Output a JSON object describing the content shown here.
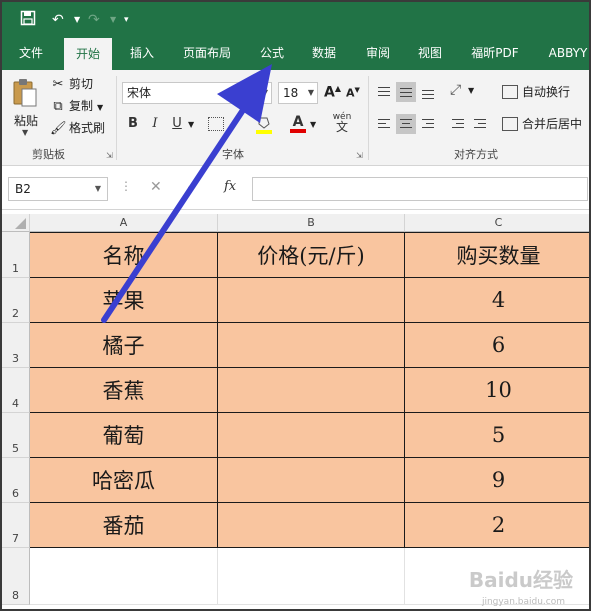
{
  "quick_access": {
    "save_icon": "save-icon",
    "undo_icon": "undo-icon",
    "redo_icon": "redo-icon",
    "customize_icon": "customize-icon"
  },
  "tabs": [
    {
      "label": "文件"
    },
    {
      "label": "开始"
    },
    {
      "label": "插入"
    },
    {
      "label": "页面布局"
    },
    {
      "label": "公式"
    },
    {
      "label": "数据"
    },
    {
      "label": "审阅"
    },
    {
      "label": "视图"
    },
    {
      "label": "福昕PDF"
    },
    {
      "label": "ABBYY"
    }
  ],
  "ribbon": {
    "clipboard": {
      "paste_label": "粘贴",
      "cut_label": "剪切",
      "copy_label": "复制",
      "format_painter_label": "格式刷",
      "group_label": "剪贴板"
    },
    "font": {
      "font_name": "宋体",
      "font_size": "18",
      "group_label": "字体",
      "bold": "B",
      "italic": "I",
      "underline": "U",
      "grow": "A",
      "shrink": "A",
      "font_color_glyph": "A",
      "phonetic_glyph": "wén"
    },
    "alignment": {
      "wrap_text_label": "自动换行",
      "merge_center_label": "合并后居中",
      "group_label": "对齐方式"
    }
  },
  "formula_bar": {
    "name_box": "B2",
    "fx": "fx",
    "cancel": "✕",
    "enter": "✓",
    "value": ""
  },
  "sheet": {
    "columns": [
      "A",
      "B",
      "C"
    ],
    "rows": [
      {
        "num": "1",
        "a": "名称",
        "b": "价格(元/斤)",
        "c": "购买数量"
      },
      {
        "num": "2",
        "a": "苹果",
        "b": "",
        "c": "4"
      },
      {
        "num": "3",
        "a": "橘子",
        "b": "",
        "c": "6"
      },
      {
        "num": "4",
        "a": "香蕉",
        "b": "",
        "c": "10"
      },
      {
        "num": "5",
        "a": "葡萄",
        "b": "",
        "c": "5"
      },
      {
        "num": "6",
        "a": "哈密瓜",
        "b": "",
        "c": "9"
      },
      {
        "num": "7",
        "a": "番茄",
        "b": "",
        "c": "2"
      },
      {
        "num": "8",
        "a": "",
        "b": "",
        "c": ""
      }
    ],
    "fill_color": "#f9c59f"
  },
  "colors": {
    "excel_green": "#217346",
    "arrow": "#3a3fd0",
    "highlight_yellow": "#ffff00",
    "font_red": "#e00000"
  },
  "watermark": {
    "text": "Baidu经验",
    "sub": "jingyan.baidu.com"
  }
}
